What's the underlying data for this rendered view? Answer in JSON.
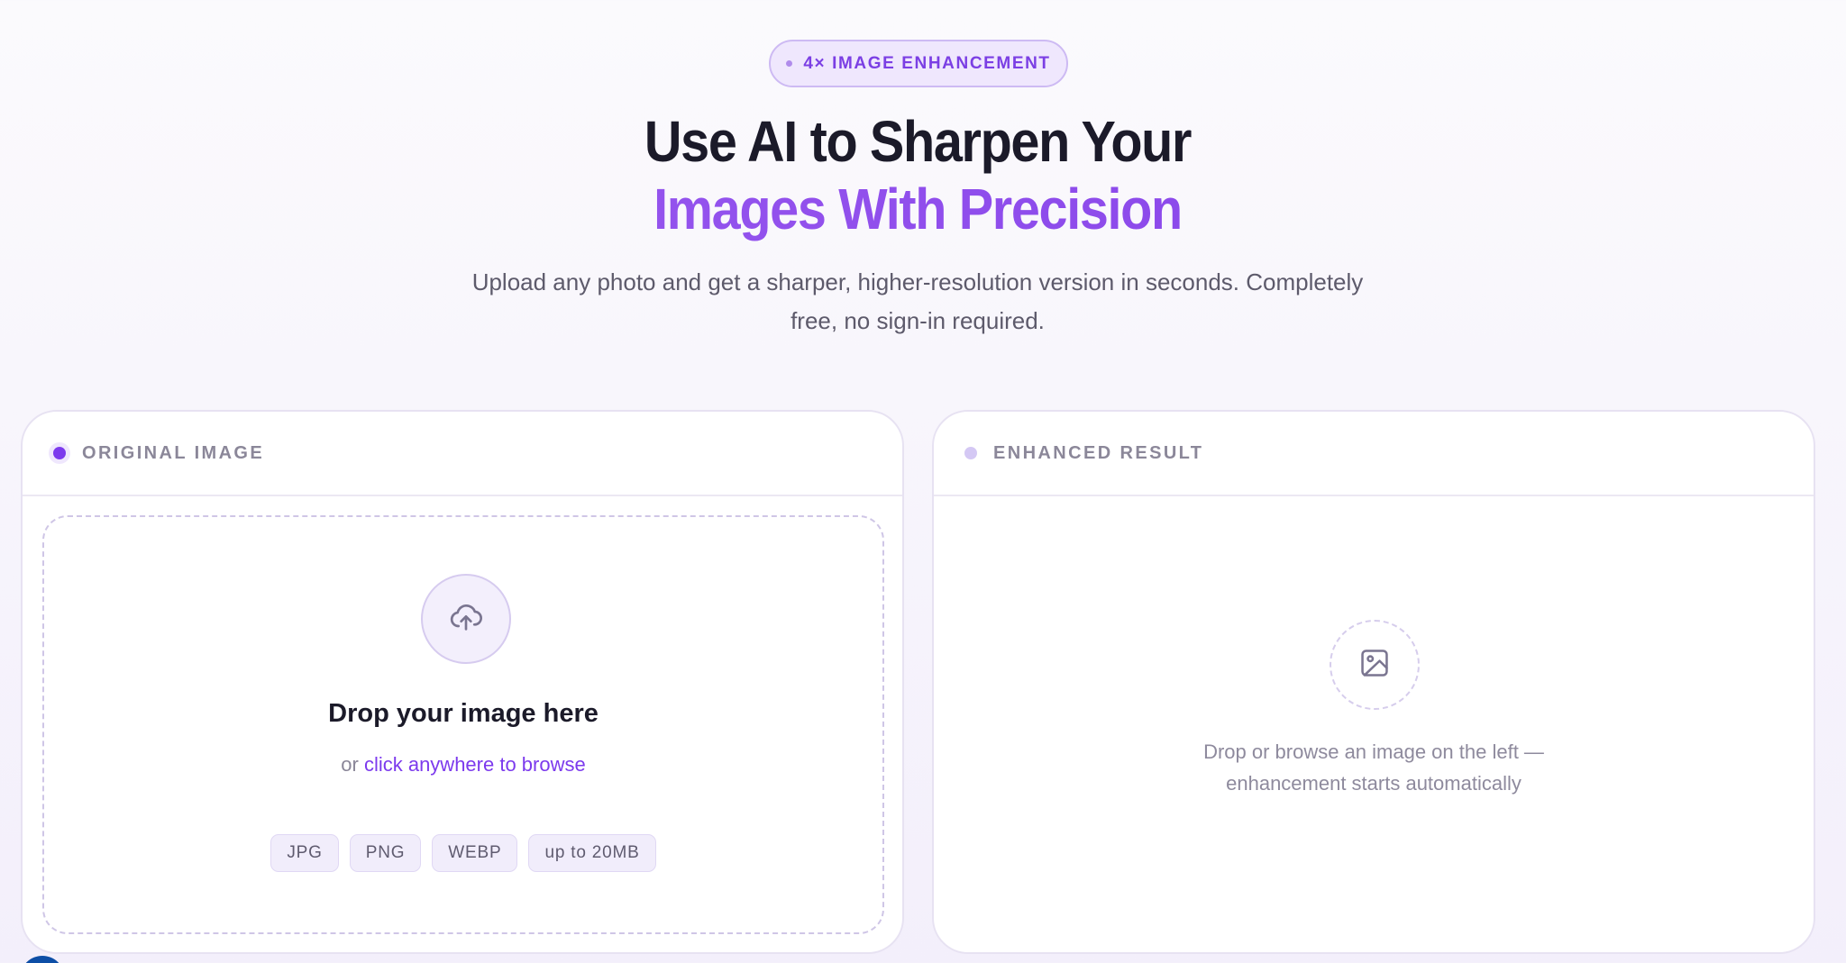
{
  "hero": {
    "badge": "4× IMAGE ENHANCEMENT",
    "title_line1": "Use AI to Sharpen Your",
    "title_line2": "Images With Precision",
    "subtitle_line1": "Upload any photo and get a sharper, higher-resolution version in seconds. Completely",
    "subtitle_line2": "free, no sign-in required."
  },
  "original_panel": {
    "label": "ORIGINAL IMAGE",
    "drop_title": "Drop your image here",
    "drop_prefix": "or",
    "browse_link": "click anywhere to browse",
    "chips": [
      "JPG",
      "PNG",
      "WEBP",
      "up to 20MB"
    ]
  },
  "result_panel": {
    "label": "ENHANCED RESULT",
    "empty_line1": "Drop or browse an image on the left —",
    "empty_line2": "enhancement starts automatically"
  },
  "icons": {
    "upload": "cloud-upload-icon",
    "placeholder": "image-icon"
  },
  "colors": {
    "accent": "#7c3aed",
    "accent_light": "#9b5cf0",
    "heading": "#1b1a29",
    "muted": "#8a8698"
  }
}
